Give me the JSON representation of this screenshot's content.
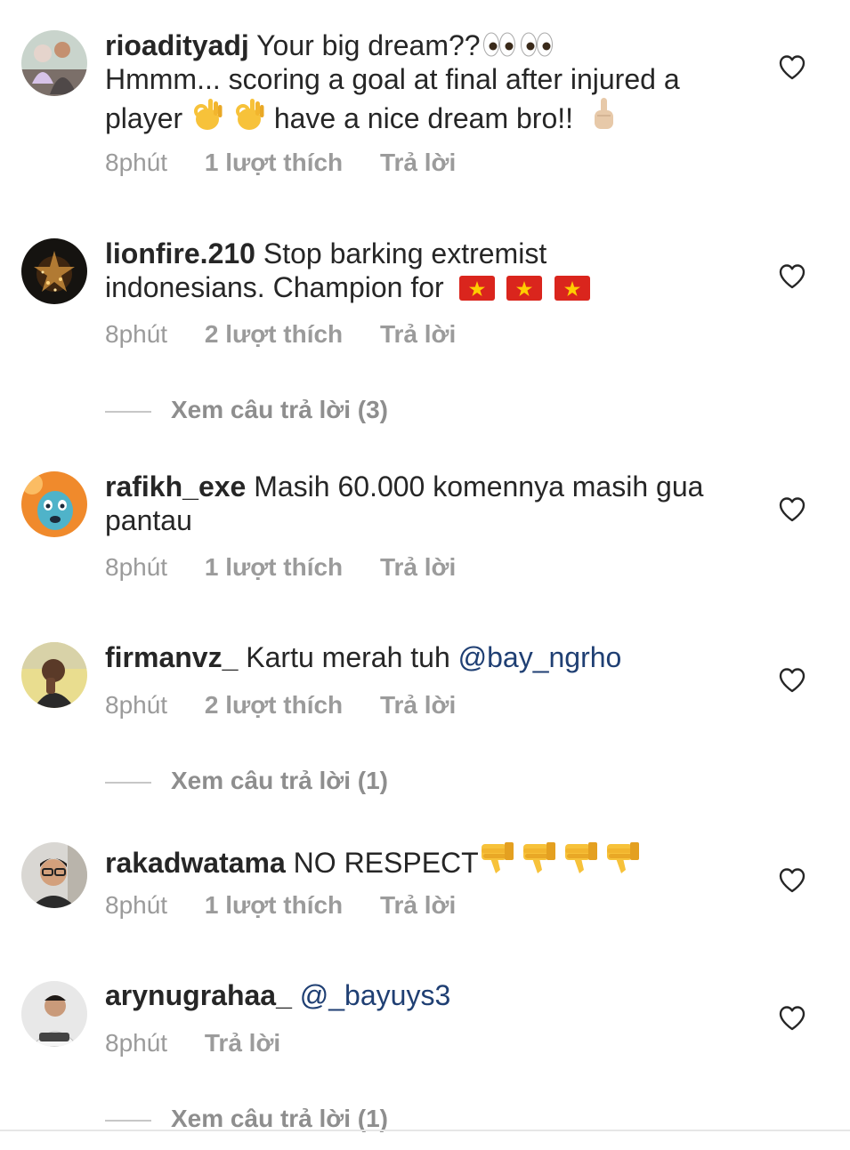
{
  "comments": [
    {
      "username": "rioadityadj",
      "text_1": "Your big dream??",
      "text_2": "Hmmm... scoring a goal at final after injured a",
      "text_3": "player",
      "text_4": "have a nice dream bro!!",
      "time": "8phút",
      "likes": "1 lượt thích",
      "reply": "Trả lời"
    },
    {
      "username": "lionfire.210",
      "text_1": "Stop barking  extremist",
      "text_2": "indonesians. Champion for",
      "time": "8phút",
      "likes": "2 lượt thích",
      "reply": "Trả lời",
      "view_replies": "Xem câu trả lời (3)"
    },
    {
      "username": "rafikh_exe",
      "text_1": "Masih 60.000 komennya masih gua",
      "text_2": "pantau",
      "time": "8phút",
      "likes": "1 lượt thích",
      "reply": "Trả lời"
    },
    {
      "username": "firmanvz_",
      "text_1": "Kartu merah tuh",
      "mention": "@bay_ngrho",
      "time": "8phút",
      "likes": "2 lượt thích",
      "reply": "Trả lời",
      "view_replies": "Xem câu trả lời (1)"
    },
    {
      "username": "rakadwatama",
      "text_1": "NO RESPECT",
      "time": "8phút",
      "likes": "1 lượt thích",
      "reply": "Trả lời"
    },
    {
      "username": "arynugrahaa_",
      "mention": "@_bayuys3",
      "time": "8phút",
      "reply": "Trả lời",
      "view_replies": "Xem câu trả lời (1)"
    }
  ],
  "icons": {
    "like": "heart-outline-icon",
    "eyes": "eyes-emoji",
    "ok_hand": "ok-hand-emoji",
    "middle_finger": "middle-finger-emoji",
    "vietnam_flag": "vietnam-flag-emoji",
    "thumbs_down": "thumbs-down-emoji"
  },
  "colors": {
    "text": "#262626",
    "meta": "#9b9b9b",
    "mention": "#1f3f73",
    "vietnam_red": "#da251d",
    "vietnam_star": "#ffcd00"
  }
}
